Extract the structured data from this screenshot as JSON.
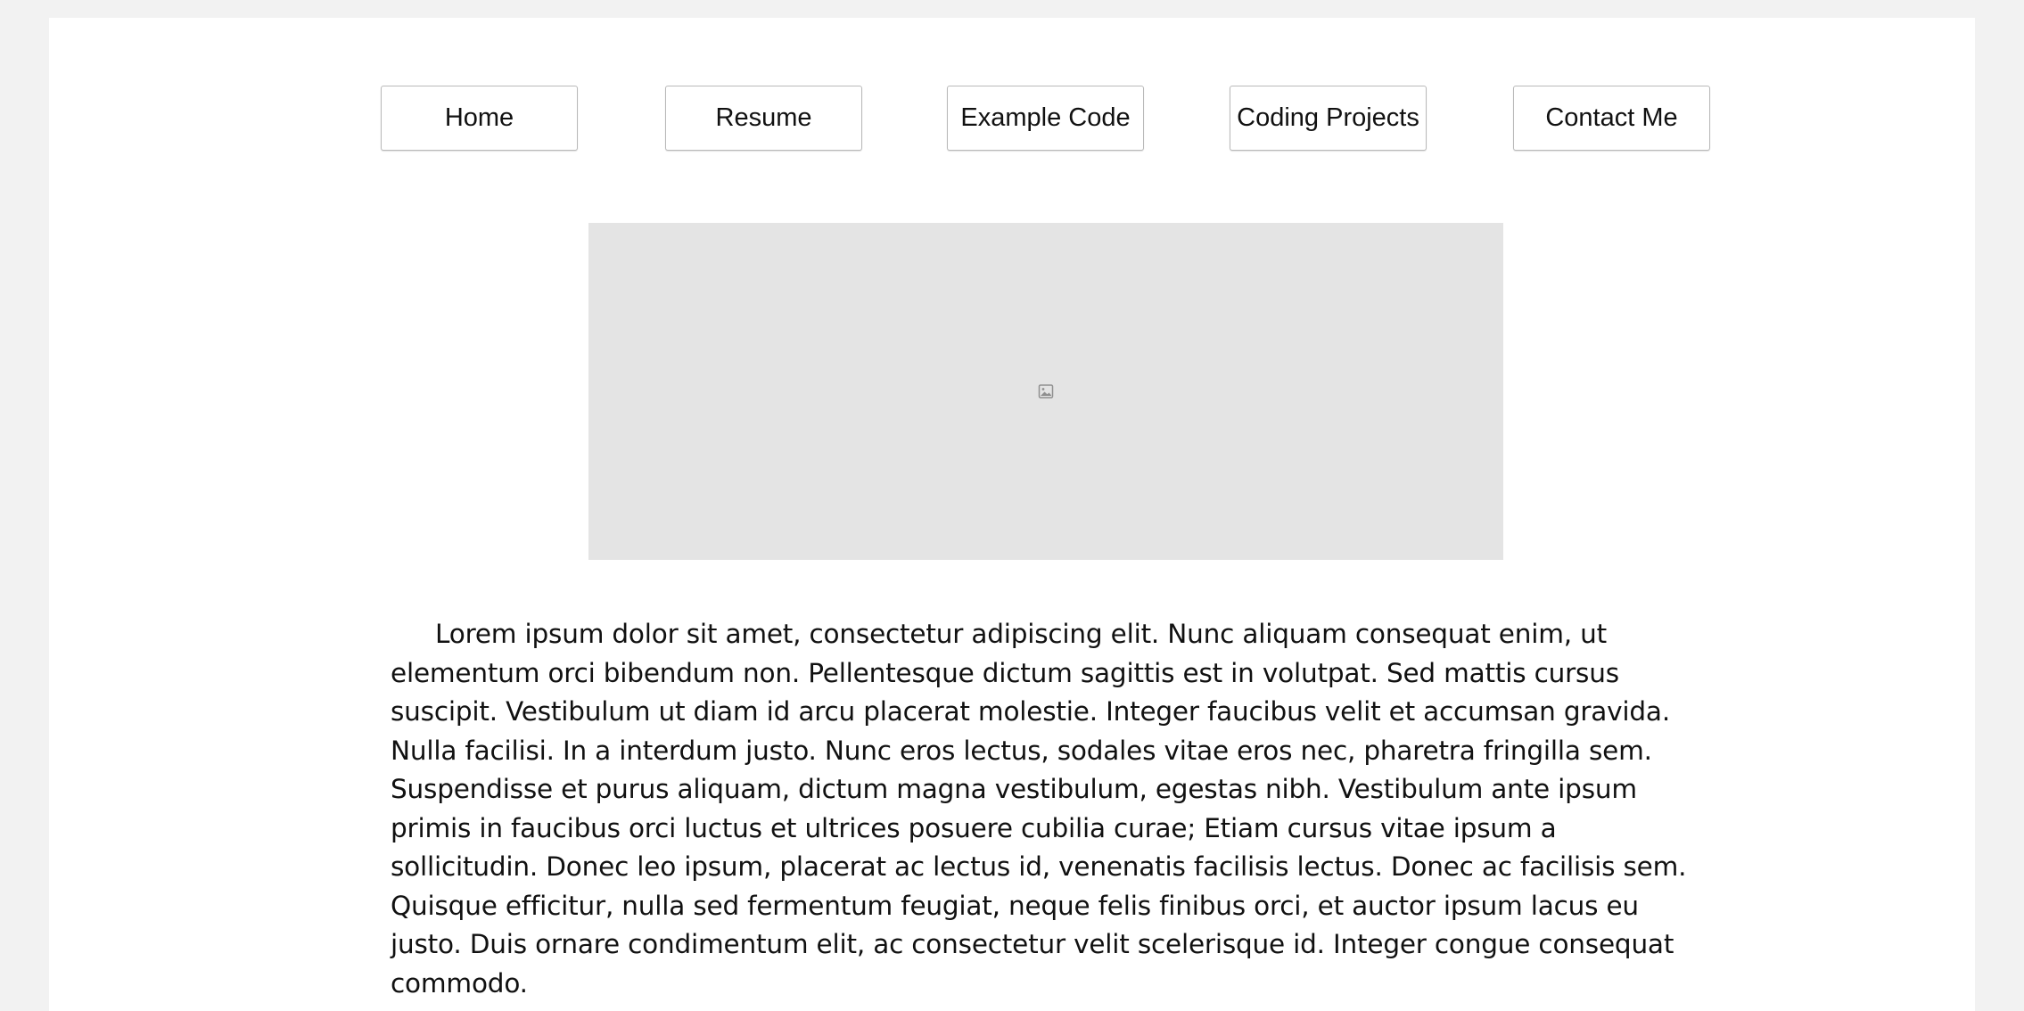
{
  "nav": {
    "items": [
      {
        "label": "Home"
      },
      {
        "label": "Resume"
      },
      {
        "label": "Example Code"
      },
      {
        "label": "Coding Projects"
      },
      {
        "label": "Contact Me"
      }
    ]
  },
  "hero": {
    "icon": "image-placeholder-icon",
    "background": "#e4e4e4"
  },
  "content": {
    "paragraph": "Lorem ipsum dolor sit amet, consectetur adipiscing elit. Nunc aliquam consequat enim, ut elementum orci bibendum non. Pellentesque dictum sagittis est in volutpat. Sed mattis cursus suscipit. Vestibulum ut diam id arcu placerat molestie. Integer faucibus velit et accumsan gravida. Nulla facilisi. In a interdum justo. Nunc eros lectus, sodales vitae eros nec, pharetra fringilla sem. Suspendisse et purus aliquam, dictum magna vestibulum, egestas nibh. Vestibulum ante ipsum primis in faucibus orci luctus et ultrices posuere cubilia curae; Etiam cursus vitae ipsum a sollicitudin. Donec leo ipsum, placerat ac lectus id, venenatis facilisis lectus. Donec ac facilisis sem. Quisque efficitur, nulla sed fermentum feugiat, neque felis finibus orci, et auctor ipsum lacus eu justo. Duis ornare condimentum elit, ac consectetur velit scelerisque id. Integer congue consequat commodo."
  }
}
